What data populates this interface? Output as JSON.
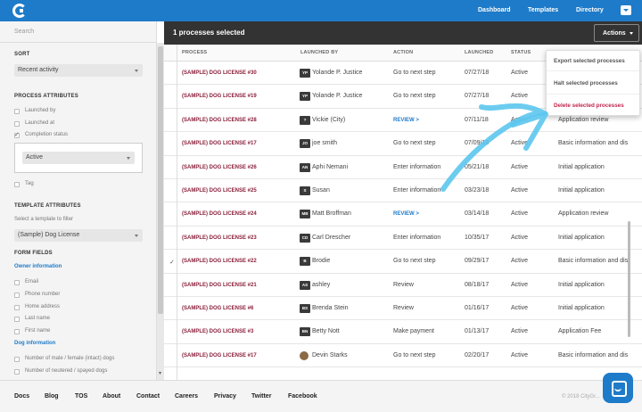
{
  "nav": {
    "links": [
      "Dashboard",
      "Templates",
      "Directory"
    ],
    "dropdown_icon": "chevron-down-icon"
  },
  "sidebar": {
    "search_placeholder": "Search",
    "sort": {
      "heading": "SORT",
      "selected": "Recent activity"
    },
    "process_attributes": {
      "heading": "PROCESS ATTRIBUTES",
      "items": [
        {
          "label": "Launched by",
          "checked": false
        },
        {
          "label": "Launched at",
          "checked": false
        },
        {
          "label": "Completion status",
          "checked": true
        }
      ],
      "status_selected": "Active",
      "tag_label": "Tag"
    },
    "template_attributes": {
      "heading": "TEMPLATE ATTRIBUTES",
      "hint": "Select a template to filter",
      "selected": "(Sample) Dog License"
    },
    "form_fields": {
      "heading": "FORM FIELDS",
      "owner_heading": "Owner information",
      "owner_items": [
        "Email",
        "Phone number",
        "Home address",
        "Last name",
        "First name"
      ],
      "dog_heading": "Dog information",
      "dog_items": [
        "Number of male / female (intact) dogs",
        "Number of neutered / spayed dogs"
      ]
    }
  },
  "toolbar": {
    "selection_text": "1 processes selected",
    "actions_label": "Actions",
    "dropdown": {
      "export": "Export selected processes",
      "halt": "Halt selected processes",
      "delete": "Delete selected processes"
    }
  },
  "table": {
    "headers": [
      "PROCESS",
      "LAUNCHED BY",
      "ACTION",
      "LAUNCHED",
      "STATUS"
    ],
    "rows": [
      {
        "process": "(SAMPLE) DOG LICENSE  #30",
        "initials": "YP",
        "launched_by": "Yolande P. Justice",
        "action": "Go to next step",
        "launched": "07/27/18",
        "status": "Active",
        "step": "",
        "checked": false
      },
      {
        "process": "(SAMPLE) DOG LICENSE  #19",
        "initials": "YP",
        "launched_by": "Yolande P. Justice",
        "action": "Go to next step",
        "launched": "07/27/18",
        "status": "Active",
        "step": "",
        "checked": false
      },
      {
        "process": "(SAMPLE) DOG LICENSE  #28",
        "initials": "?",
        "launched_by": "Vickie (City)",
        "action": "REVIEW >",
        "launched": "07/11/18",
        "status": "Active",
        "step": "Application review",
        "checked": false
      },
      {
        "process": "(SAMPLE) DOG LICENSE  #17",
        "initials": "JO",
        "launched_by": "joe smith",
        "action": "Go to next step",
        "launched": "07/09/18",
        "status": "Active",
        "step": "Basic information and dis",
        "checked": false
      },
      {
        "process": "(SAMPLE) DOG LICENSE  #26",
        "initials": "AN",
        "launched_by": "Aphi Nemani",
        "action": "Enter information",
        "launched": "05/21/18",
        "status": "Active",
        "step": "Initial application",
        "checked": false
      },
      {
        "process": "(SAMPLE) DOG LICENSE  #25",
        "initials": "S",
        "launched_by": "Susan",
        "action": "Enter information",
        "launched": "03/23/18",
        "status": "Active",
        "step": "Initial application",
        "checked": false
      },
      {
        "process": "(SAMPLE) DOG LICENSE  #24",
        "initials": "MB",
        "launched_by": "Matt Broffman",
        "action": "REVIEW >",
        "launched": "03/14/18",
        "status": "Active",
        "step": "Application review",
        "checked": false
      },
      {
        "process": "(SAMPLE) DOG LICENSE  #23",
        "initials": "CD",
        "launched_by": "Carl Drescher",
        "action": "Enter information",
        "launched": "10/35/17",
        "status": "Active",
        "step": "Initial application",
        "checked": false
      },
      {
        "process": "(SAMPLE) DOG LICENSE  #22",
        "initials": "B",
        "launched_by": "Brodie",
        "action": "Go to next step",
        "launched": "09/29/17",
        "status": "Active",
        "step": "Basic information and dis",
        "checked": true
      },
      {
        "process": "(SAMPLE) DOG LICENSE  #21",
        "initials": "AS",
        "launched_by": "ashley",
        "action": "Review",
        "launched": "08/18/17",
        "status": "Active",
        "step": "Initial application",
        "checked": false
      },
      {
        "process": "(SAMPLE) DOG LICENSE  #6",
        "initials": "BS",
        "launched_by": "Brenda Stein",
        "action": "Review",
        "launched": "01/16/17",
        "status": "Active",
        "step": "Initial application",
        "checked": false
      },
      {
        "process": "(SAMPLE) DOG LICENSE  #3",
        "initials": "BN",
        "launched_by": "Betty Nott",
        "action": "Make payment",
        "launched": "01/13/17",
        "status": "Active",
        "step": "Application Fee",
        "checked": false
      },
      {
        "process": "(SAMPLE) DOG LICENSE  #17",
        "initials": "",
        "launched_by": "Devin Starks",
        "action": "Go to next step",
        "launched": "02/20/17",
        "status": "Active",
        "step": "Basic information and dis",
        "checked": false
      }
    ]
  },
  "footer": {
    "links": [
      "Docs",
      "Blog",
      "TOS",
      "About",
      "Contact",
      "Careers",
      "Privacy",
      "Twitter",
      "Facebook"
    ],
    "copyright": "© 2018 CityGr..."
  },
  "colors": {
    "brand": "#1e7bc9",
    "header_dark": "#333333",
    "process_link": "#8a1f3a",
    "danger": "#c0254b",
    "annotation_arrow": "#5cc6ee"
  },
  "annotation": {
    "type": "hand-drawn-arrow",
    "points_to": "delete-selected-processes"
  }
}
